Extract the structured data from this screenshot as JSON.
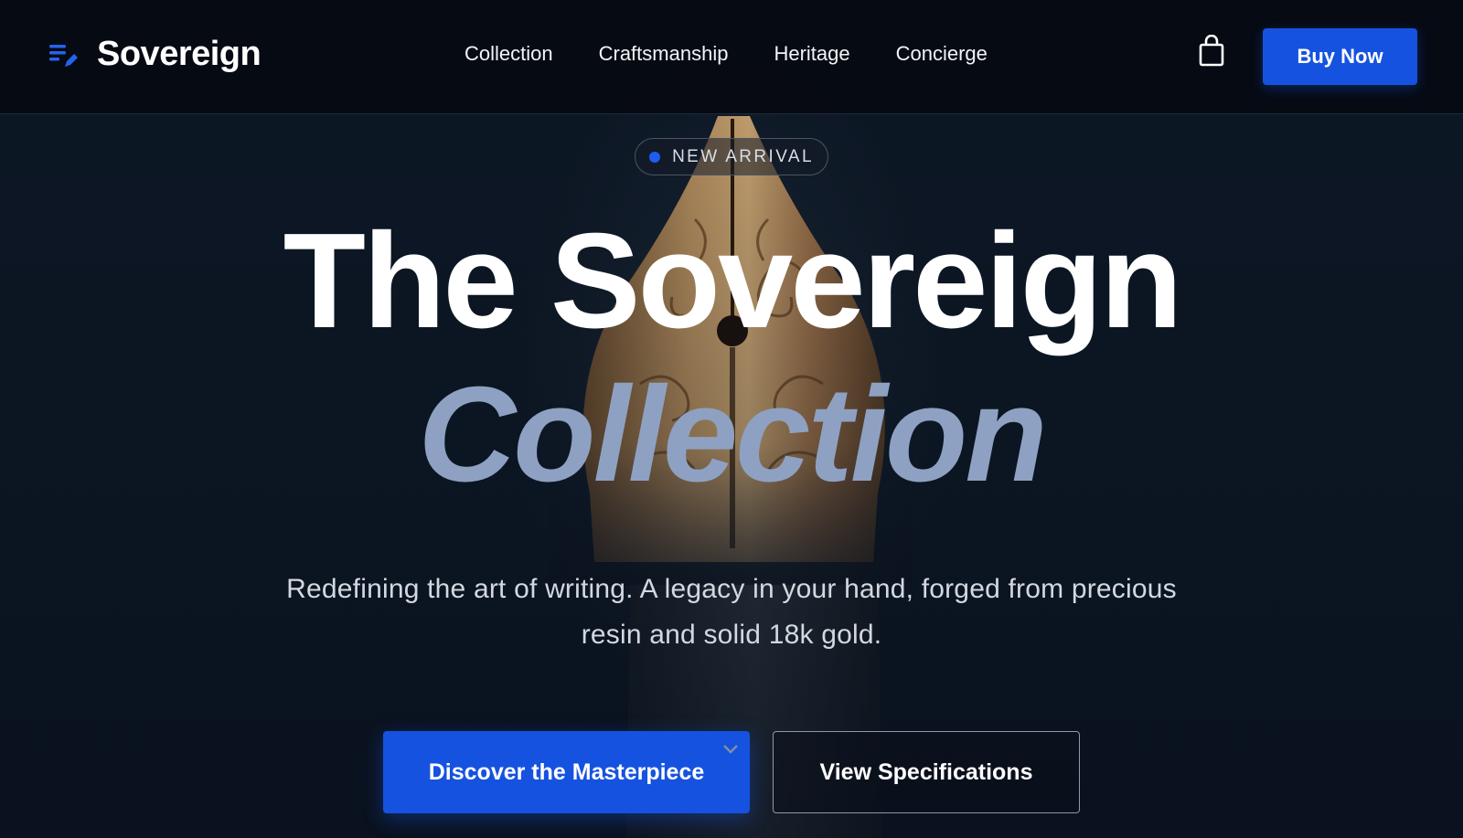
{
  "nav": {
    "brand": "Sovereign",
    "links": [
      "Collection",
      "Craftsmanship",
      "Heritage",
      "Concierge"
    ],
    "buy_label": "Buy Now"
  },
  "hero": {
    "badge": "NEW ARRIVAL",
    "title_line1": "The Sovereign",
    "title_line2": "Collection",
    "subtitle": "Redefining the art of writing. A legacy in your hand, forged from precious resin and solid 18k gold.",
    "primary_cta": "Discover the Masterpiece",
    "secondary_cta": "View Specifications"
  },
  "icons": {
    "brand": "pen-list-icon",
    "cart": "shopping-bag-icon",
    "chevron": "chevron-down-icon"
  },
  "colors": {
    "accent": "#1652e0",
    "title_italic": "#8ea1c2",
    "background": "#0b1320",
    "nib_gold": "#b98a55"
  }
}
